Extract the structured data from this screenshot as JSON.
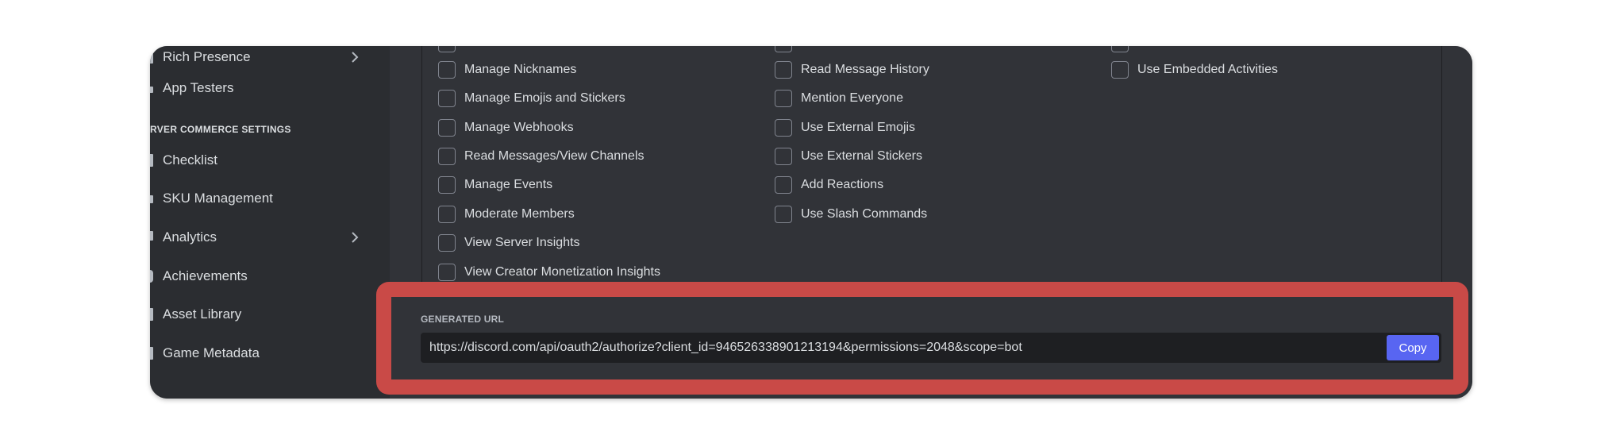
{
  "sidebar": {
    "items": [
      {
        "label": "Rich Presence",
        "chevron": true,
        "icon": "rich-presence-icon"
      },
      {
        "label": "App Testers",
        "chevron": false,
        "icon": "testers-icon"
      }
    ],
    "section_header": "RVER COMMERCE SETTINGS",
    "commerce_items": [
      {
        "label": "Checklist",
        "chevron": false,
        "icon": "checklist-icon"
      },
      {
        "label": "SKU Management",
        "chevron": false,
        "icon": "sku-icon"
      },
      {
        "label": "Analytics",
        "chevron": true,
        "icon": "analytics-icon"
      },
      {
        "label": "Achievements",
        "chevron": false,
        "icon": "achievements-icon"
      },
      {
        "label": "Asset Library",
        "chevron": false,
        "icon": "asset-library-icon"
      },
      {
        "label": "Game Metadata",
        "chevron": false,
        "icon": "game-metadata-icon"
      }
    ]
  },
  "permissions": {
    "column1": [
      "Manage Nicknames",
      "Manage Emojis and Stickers",
      "Manage Webhooks",
      "Read Messages/View Channels",
      "Manage Events",
      "Moderate Members",
      "View Server Insights",
      "View Creator Monetization Insights"
    ],
    "column2": [
      "Read Message History",
      "Mention Everyone",
      "Use External Emojis",
      "Use External Stickers",
      "Add Reactions",
      "Use Slash Commands"
    ],
    "column3": [
      "Use Embedded Activities"
    ]
  },
  "generated_url": {
    "label": "GENERATED URL",
    "value": "https://discord.com/api/oauth2/authorize?client_id=946526338901213194&permissions=2048&scope=bot",
    "copy_label": "Copy"
  },
  "colors": {
    "highlight": "#c94a47",
    "accent": "#5865f2",
    "background": "#313338"
  }
}
